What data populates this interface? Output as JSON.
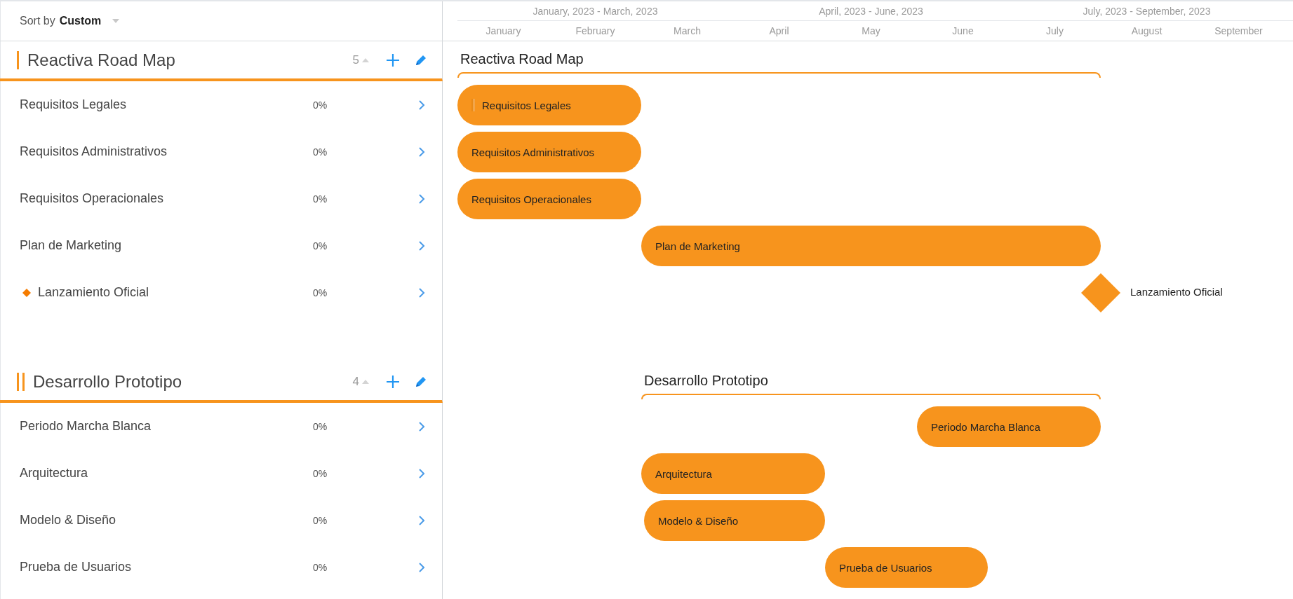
{
  "sort": {
    "label": "Sort by **Custom**"
  },
  "timeline": {
    "quarters": [
      {
        "label": "January, 2023 - March, 2023"
      },
      {
        "label": "April, 2023 - June, 2023"
      },
      {
        "label": "July, 2023 - September, 2023"
      }
    ],
    "months": [
      "January",
      "February",
      "March",
      "April",
      "May",
      "June",
      "July",
      "August",
      "September"
    ]
  },
  "groups": [
    {
      "title": "Reactiva Road Map",
      "timeline_title": "Reactiva Road Map",
      "count": "5",
      "selected": false,
      "tasks": [
        {
          "kind": "task",
          "name": "Requisitos Legales",
          "progress": "0%",
          "bar_label": "Requisitos Legales",
          "hovered": true
        },
        {
          "kind": "task",
          "name": "Requisitos Administrativos",
          "progress": "0%",
          "bar_label": "Requisitos Administrativos",
          "hovered": false
        },
        {
          "kind": "task",
          "name": "Requisitos Operacionales",
          "progress": "0%",
          "bar_label": "Requisitos Operacionales",
          "hovered": false
        },
        {
          "kind": "task",
          "name": "Plan de Marketing",
          "progress": "0%",
          "bar_label": "Plan de Marketing",
          "hovered": false
        },
        {
          "kind": "milestone",
          "name": "Lanzamiento Oficial",
          "progress": "0%",
          "bar_label": "Lanzamiento Oficial",
          "hovered": false
        }
      ]
    },
    {
      "title": "Desarrollo Prototipo",
      "timeline_title": "Desarrollo Prototipo",
      "count": "4",
      "selected": true,
      "tasks": [
        {
          "kind": "task",
          "name": "Periodo Marcha Blanca",
          "progress": "0%",
          "bar_label": "Periodo Marcha Blanca",
          "hovered": false
        },
        {
          "kind": "task",
          "name": "Arquitectura",
          "progress": "0%",
          "bar_label": "Arquitectura",
          "hovered": false
        },
        {
          "kind": "task",
          "name": "Modelo & Diseño",
          "progress": "0%",
          "bar_label": "Modelo & Diseño",
          "hovered": false
        },
        {
          "kind": "task",
          "name": "Prueba de Usuarios",
          "progress": "0%",
          "bar_label": "Prueba de Usuarios",
          "hovered": false
        }
      ]
    }
  ]
}
